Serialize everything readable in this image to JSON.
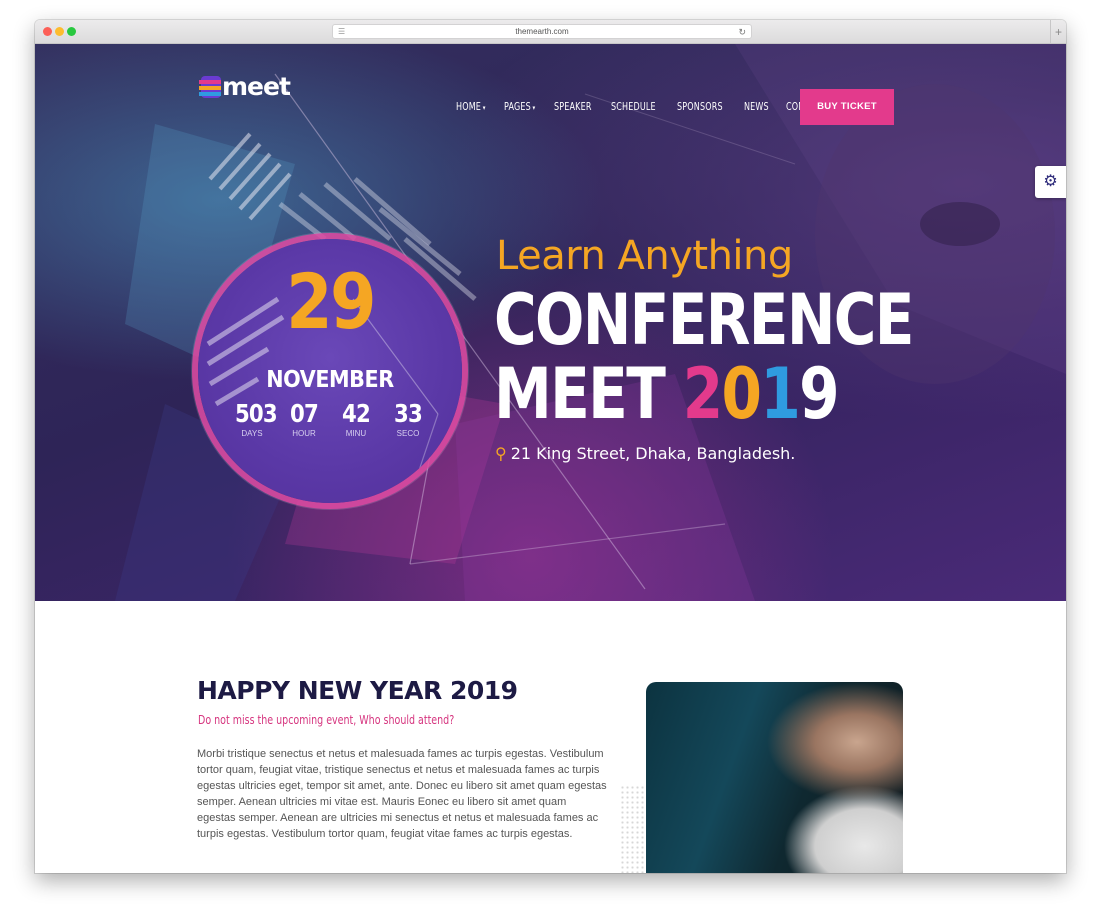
{
  "browser": {
    "url": "themearth.com"
  },
  "brand": {
    "logo_text": "meet"
  },
  "nav": {
    "items": [
      {
        "label": "HOME",
        "has_dropdown": true
      },
      {
        "label": "PAGES",
        "has_dropdown": true
      },
      {
        "label": "SPEAKER",
        "has_dropdown": false
      },
      {
        "label": "SCHEDULE",
        "has_dropdown": false
      },
      {
        "label": "SPONSORS",
        "has_dropdown": false
      },
      {
        "label": "NEWS",
        "has_dropdown": false
      },
      {
        "label": "CONTACT",
        "has_dropdown": false
      }
    ],
    "cta_label": "BUY TICKET",
    "dropdown_caret": "▾"
  },
  "settings": {
    "icon": "gear-icon",
    "glyph": "⚙"
  },
  "event": {
    "day": "29",
    "month": "NOVEMBER",
    "countdown": [
      {
        "value": "503",
        "label": "DAYS"
      },
      {
        "value": "07",
        "label": "HOUR"
      },
      {
        "value": "42",
        "label": "MINU"
      },
      {
        "value": "33",
        "label": "SECO"
      }
    ],
    "kicker": "Learn Anything",
    "title_line1": "CONFERENCE",
    "title_line2_prefix": "MEET",
    "year_digits": [
      "2",
      "0",
      "1",
      "9"
    ],
    "address": "21 King Street, Dhaka, Bangladesh.",
    "pin_glyph": "⚲"
  },
  "about": {
    "title": "HAPPY NEW YEAR 2019",
    "subtitle": "Do not miss the upcoming event, Who should attend?",
    "body": "Morbi tristique senectus et netus et malesuada fames ac turpis egestas. Vestibulum tortor quam, feugiat vitae, tristique senectus et netus et malesuada fames ac turpis egestas ultricies eget, tempor sit amet, ante. Donec eu libero sit amet quam egestas semper. Aenean ultricies mi vitae est. Mauris Eonec eu libero sit amet quam egestas semper. Aenean are ultricies mi senectus et netus et malesuada fames ac turpis egestas. Vestibulum tortor quam, feugiat vitae fames ac turpis egestas."
  },
  "colors": {
    "accent_pink": "#e33a8c",
    "accent_orange": "#f5a623",
    "accent_blue": "#2f9be0",
    "hero_bg": "#2e2457",
    "heading_dark": "#1d1a44"
  }
}
